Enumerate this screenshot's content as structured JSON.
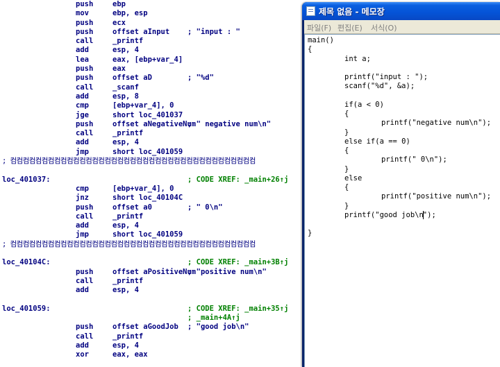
{
  "disassembly": {
    "lines": [
      {
        "mn": "push",
        "op": "ebp"
      },
      {
        "mn": "mov",
        "op": "ebp, esp"
      },
      {
        "mn": "push",
        "op": "ecx"
      },
      {
        "mn": "push",
        "op": "offset aInput",
        "cm": "; \"input : \""
      },
      {
        "mn": "call",
        "op": "_printf"
      },
      {
        "mn": "add",
        "op": "esp, 4"
      },
      {
        "mn": "lea",
        "op": "eax, [ebp+var_4]"
      },
      {
        "mn": "push",
        "op": "eax"
      },
      {
        "mn": "push",
        "op": "offset aD",
        "cm": "; \"%d\""
      },
      {
        "mn": "call",
        "op": "_scanf"
      },
      {
        "mn": "add",
        "op": "esp, 8"
      },
      {
        "mn": "cmp",
        "op": "[ebp+var_4], 0"
      },
      {
        "mn": "jge",
        "op": "short loc_401037"
      },
      {
        "mn": "push",
        "op": "offset aNegativeNum",
        "cm": "; \" negative num\\n\""
      },
      {
        "mn": "call",
        "op": "_printf"
      },
      {
        "mn": "add",
        "op": "esp, 4"
      },
      {
        "mn": "jmp",
        "op": "short loc_401059"
      },
      {
        "sep": "; 컴컴컴컴컴컴컴컴컴컴컴컴컴컴컴컴컴컴컴컴컴컴컴컴컴컴컴컴컴컴컴컴컴컴컴컴컴컴컴"
      },
      {},
      {
        "lbl": "loc_401037:",
        "xr": "; CODE XREF: _main+26↑j"
      },
      {
        "mn": "cmp",
        "op": "[ebp+var_4], 0"
      },
      {
        "mn": "jnz",
        "op": "short loc_40104C"
      },
      {
        "mn": "push",
        "op": "offset a0",
        "cm": "; \" 0\\n\""
      },
      {
        "mn": "call",
        "op": "_printf"
      },
      {
        "mn": "add",
        "op": "esp, 4"
      },
      {
        "mn": "jmp",
        "op": "short loc_401059"
      },
      {
        "sep": "; 컴컴컴컴컴컴컴컴컴컴컴컴컴컴컴컴컴컴컴컴컴컴컴컴컴컴컴컴컴컴컴컴컴컴컴컴컴컴컴"
      },
      {},
      {
        "lbl": "loc_40104C:",
        "xr": "; CODE XREF: _main+3B↑j"
      },
      {
        "mn": "push",
        "op": "offset aPositiveNum",
        "cm": "; \"positive num\\n\""
      },
      {
        "mn": "call",
        "op": "_printf"
      },
      {
        "mn": "add",
        "op": "esp, 4"
      },
      {},
      {
        "lbl": "loc_401059:",
        "xr": "; CODE XREF: _main+35↑j"
      },
      {
        "xr": "; _main+4A↑j"
      },
      {
        "mn": "push",
        "op": "offset aGoodJob",
        "cm": "; \"good job\\n\""
      },
      {
        "mn": "call",
        "op": "_printf"
      },
      {
        "mn": "add",
        "op": "esp, 4"
      },
      {
        "mn": "xor",
        "op": "eax, eax"
      }
    ]
  },
  "notepad": {
    "title": "제목 없음 - 메모장",
    "icon": "notepad-icon",
    "menu": [
      "파일(F)",
      "편집(E)",
      "서식(O)"
    ],
    "code_lines": [
      {
        "indent": 0,
        "text": "main()"
      },
      {
        "indent": 0,
        "text": "{"
      },
      {
        "indent": 1,
        "text": "int a;"
      },
      {
        "indent": 0,
        "text": ""
      },
      {
        "indent": 1,
        "text": "printf(\"input : \");"
      },
      {
        "indent": 1,
        "text": "scanf(\"%d\", &a);"
      },
      {
        "indent": 0,
        "text": ""
      },
      {
        "indent": 1,
        "text": "if(a < 0)"
      },
      {
        "indent": 1,
        "text": "{"
      },
      {
        "indent": 2,
        "text": "printf(\"negative num\\n\");"
      },
      {
        "indent": 1,
        "text": "}"
      },
      {
        "indent": 1,
        "text": "else if(a == 0)"
      },
      {
        "indent": 1,
        "text": "{"
      },
      {
        "indent": 2,
        "text": "printf(\" 0\\n\");"
      },
      {
        "indent": 1,
        "text": "}"
      },
      {
        "indent": 1,
        "text": "else"
      },
      {
        "indent": 1,
        "text": "{"
      },
      {
        "indent": 2,
        "text": "printf(\"positive num\\n\");"
      },
      {
        "indent": 1,
        "text": "}"
      },
      {
        "indent": 1,
        "text": "printf(\"good job\\n",
        "caret": true,
        "after": "\");"
      },
      {
        "indent": 0,
        "text": ""
      },
      {
        "indent": 0,
        "text": "}"
      }
    ]
  }
}
